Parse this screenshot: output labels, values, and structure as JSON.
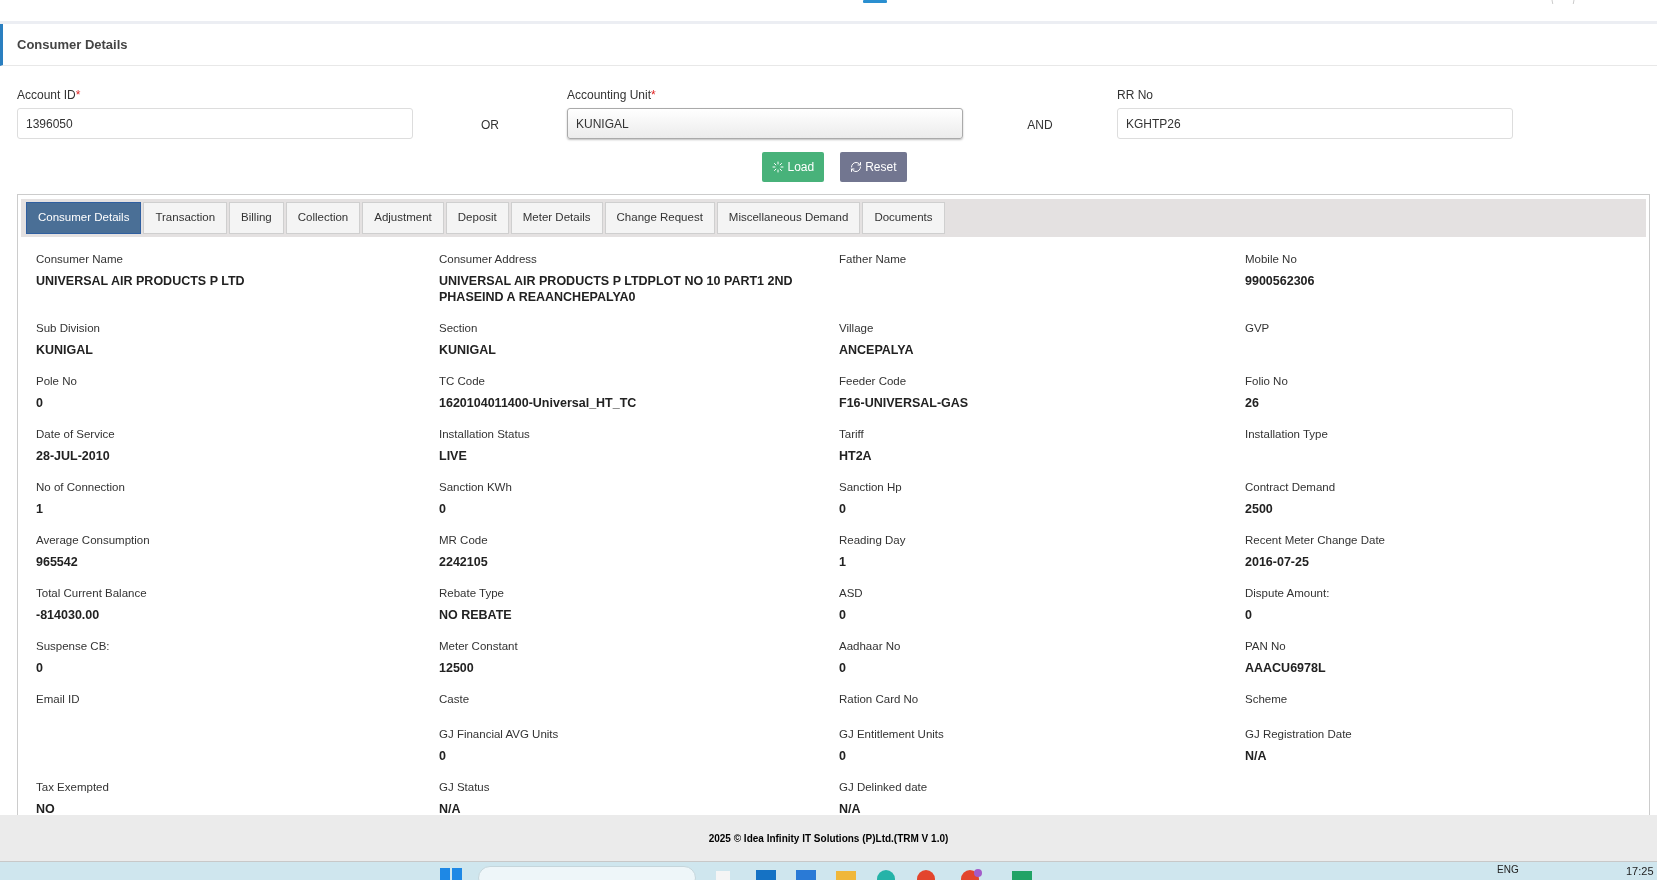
{
  "panel": {
    "title": "Consumer Details"
  },
  "search": {
    "fields": [
      {
        "label": "Account ID",
        "required_mark": "*",
        "value": "1396050",
        "kind": "text"
      },
      {
        "label": "Accounting Unit",
        "required_mark": "*",
        "value": "KUNIGAL",
        "kind": "select"
      },
      {
        "label": "RR No",
        "value": "KGHTP26",
        "kind": "text"
      }
    ],
    "connectors": [
      "OR",
      "AND"
    ],
    "buttons": [
      {
        "label": "Load",
        "kind": "load"
      },
      {
        "label": "Reset",
        "kind": "reset"
      }
    ]
  },
  "tabs": [
    {
      "label": "Consumer Details",
      "selected": true
    },
    {
      "label": "Transaction",
      "selected": false
    },
    {
      "label": "Billing",
      "selected": false
    },
    {
      "label": "Collection",
      "selected": false
    },
    {
      "label": "Adjustment",
      "selected": false
    },
    {
      "label": "Deposit",
      "selected": false
    },
    {
      "label": "Meter Details",
      "selected": false
    },
    {
      "label": "Change Request",
      "selected": false
    },
    {
      "label": "Miscellaneous Demand",
      "selected": false
    },
    {
      "label": "Documents",
      "selected": false
    }
  ],
  "details": [
    {
      "column_1": {
        "label": "Consumer Name",
        "value": "UNIVERSAL AIR PRODUCTS P LTD"
      },
      "column_2": {
        "label": "Consumer Address",
        "value": "UNIVERSAL AIR PRODUCTS P LTDPLOT NO 10 PART1 2ND PHASEIND A REAANCHEPALYA0"
      },
      "column_3": {
        "label": "Father Name"
      },
      "column_4": {
        "label": "Mobile No",
        "value": "9900562306"
      }
    },
    {
      "column_1": {
        "label": "Sub Division",
        "value": "KUNIGAL"
      },
      "column_2": {
        "label": "Section",
        "value": "KUNIGAL"
      },
      "column_3": {
        "label": "Village",
        "value": "ANCEPALYA"
      },
      "column_4": {
        "label": "GVP"
      }
    },
    {
      "column_1": {
        "label": "Pole No",
        "value": "0"
      },
      "column_2": {
        "label": "TC Code",
        "value": "1620104011400-Universal_HT_TC"
      },
      "column_3": {
        "label": "Feeder Code",
        "value": "F16-UNIVERSAL-GAS"
      },
      "column_4": {
        "label": "Folio No",
        "value": "26"
      }
    },
    {
      "column_1": {
        "label": "Date of Service",
        "value": "28-JUL-2010"
      },
      "column_2": {
        "label": "Installation Status",
        "value": "LIVE"
      },
      "column_3": {
        "label": "Tariff",
        "value": "HT2A"
      },
      "column_4": {
        "label": "Installation Type"
      }
    },
    {
      "column_1": {
        "label": "No of Connection",
        "value": "1"
      },
      "column_2": {
        "label": "Sanction KWh",
        "value": "0"
      },
      "column_3": {
        "label": "Sanction Hp",
        "value": "0"
      },
      "column_4": {
        "label": "Contract Demand",
        "value": "2500"
      }
    },
    {
      "column_1": {
        "label": "Average Consumption",
        "value": "965542"
      },
      "column_2": {
        "label": "MR Code",
        "value": "2242105"
      },
      "column_3": {
        "label": "Reading Day",
        "value": "1"
      },
      "column_4": {
        "label": "Recent Meter Change Date",
        "value": "2016-07-25"
      }
    },
    {
      "column_1": {
        "label": "Total Current Balance",
        "value": "-814030.00"
      },
      "column_2": {
        "label": "Rebate Type",
        "value": "NO REBATE"
      },
      "column_3": {
        "label": "ASD",
        "value": "0"
      },
      "column_4": {
        "label": "Dispute Amount:",
        "value": "0"
      }
    },
    {
      "column_1": {
        "label": "Suspense CB:",
        "value": "0"
      },
      "column_2": {
        "label": "Meter Constant",
        "value": "12500"
      },
      "column_3": {
        "label": "Aadhaar No",
        "value": "0"
      },
      "column_4": {
        "label": "PAN No",
        "value": "AAACU6978L"
      }
    },
    {
      "column_1": {
        "label": "Email ID"
      },
      "column_2": {
        "label": "Caste"
      },
      "column_3": {
        "label": "Ration Card No"
      },
      "column_4": {
        "label": "Scheme"
      }
    },
    {
      "column_2": {
        "label": "GJ Financial AVG Units",
        "value": "0"
      },
      "column_3": {
        "label": "GJ Entitlement Units",
        "value": "0"
      },
      "column_4": {
        "label": "GJ Registration Date",
        "value": "N/A"
      }
    },
    {
      "column_1": {
        "label": "Tax Exempted",
        "value": "NO"
      },
      "column_2": {
        "label": "GJ Status",
        "value": "N/A"
      },
      "column_3": {
        "label": "GJ Delinked date",
        "value": "N/A"
      }
    }
  ],
  "footer": "2025 © Idea Infinity IT Solutions (P)Ltd.(TRM V 1.0)",
  "taskbar": {
    "language": "ENG",
    "time": "17:25"
  }
}
